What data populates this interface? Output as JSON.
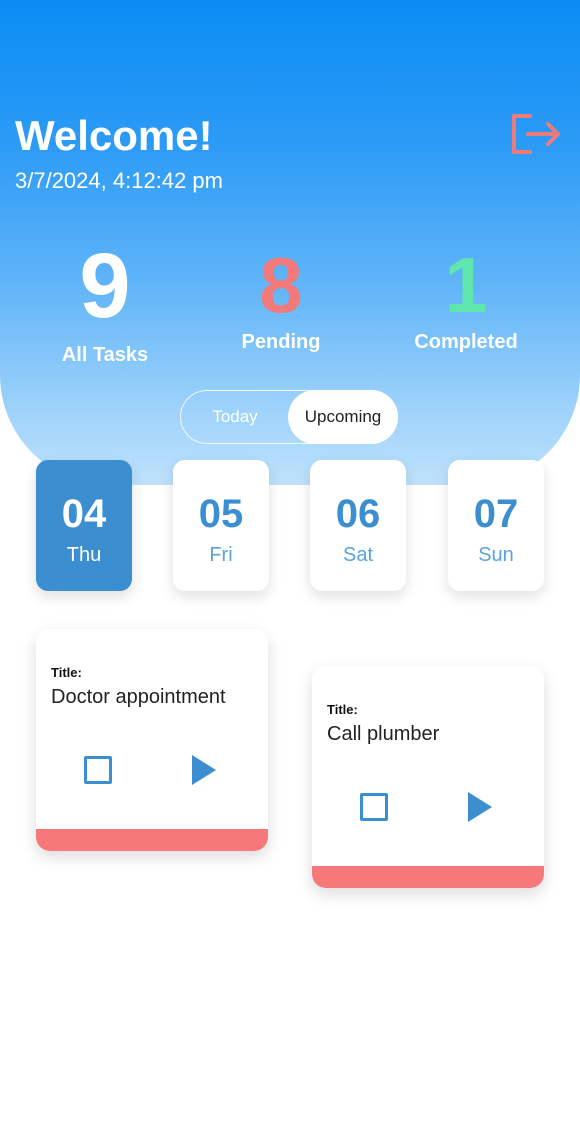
{
  "header": {
    "welcome": "Welcome!",
    "datetime": "3/7/2024, 4:12:42 pm"
  },
  "stats": {
    "all": {
      "value": "9",
      "label": "All Tasks"
    },
    "pending": {
      "value": "8",
      "label": "Pending"
    },
    "completed": {
      "value": "1",
      "label": "Completed"
    }
  },
  "toggle": {
    "today": "Today",
    "upcoming": "Upcoming",
    "selected": "Upcoming"
  },
  "days": [
    {
      "num": "04",
      "name": "Thu",
      "selected": true
    },
    {
      "num": "05",
      "name": "Fri",
      "selected": false
    },
    {
      "num": "06",
      "name": "Sat",
      "selected": false
    },
    {
      "num": "07",
      "name": "Sun",
      "selected": false
    }
  ],
  "tasks": [
    {
      "label": "Title:",
      "title": "Doctor appointment"
    },
    {
      "label": "Title:",
      "title": "Call plumber"
    }
  ],
  "colors": {
    "accent": "#3b8fd0",
    "pending": "#f37a7a",
    "completed": "#5ee6ad",
    "task_bar": "#f77878",
    "logout_icon": "#ef7a7a"
  },
  "icons": {
    "logout": "logout-icon",
    "task_checkbox": "checkbox-icon",
    "task_play": "play-icon"
  }
}
